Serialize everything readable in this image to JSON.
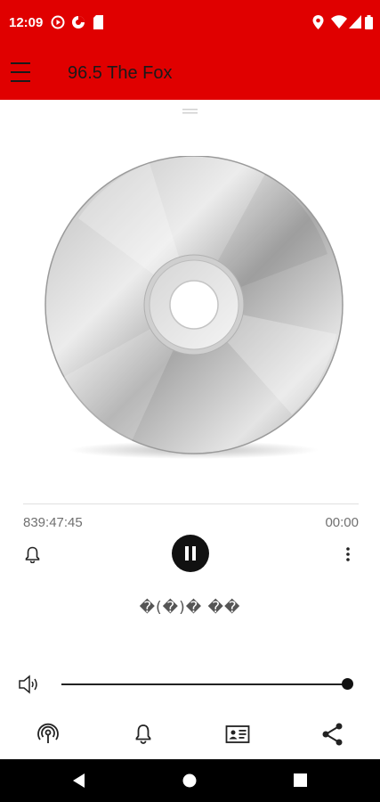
{
  "status_bar": {
    "time": "12:09",
    "icons": [
      "play-circle-icon",
      "pie-icon",
      "sd-card-icon",
      "location-icon",
      "wifi-icon",
      "signal-icon",
      "battery-icon"
    ],
    "color": "#e00000"
  },
  "app_bar": {
    "title": "96.5 The Fox",
    "menu_icon": "hamburger-menu-icon",
    "color": "#e00000"
  },
  "player": {
    "album_art": "cd-disc-image",
    "elapsed": "839:47:45",
    "total": "00:00",
    "track_title": "�(�)� ��",
    "volume_level": 1.0,
    "controls": {
      "alarm_icon": "bell-icon",
      "play_state_icon": "pause-icon",
      "more_icon": "more-vert-icon"
    }
  },
  "bottom_actions": [
    "podcast-icon",
    "bell-icon",
    "contact-card-icon",
    "share-icon"
  ],
  "nav_bar": [
    "back-icon",
    "home-icon",
    "recents-icon"
  ]
}
